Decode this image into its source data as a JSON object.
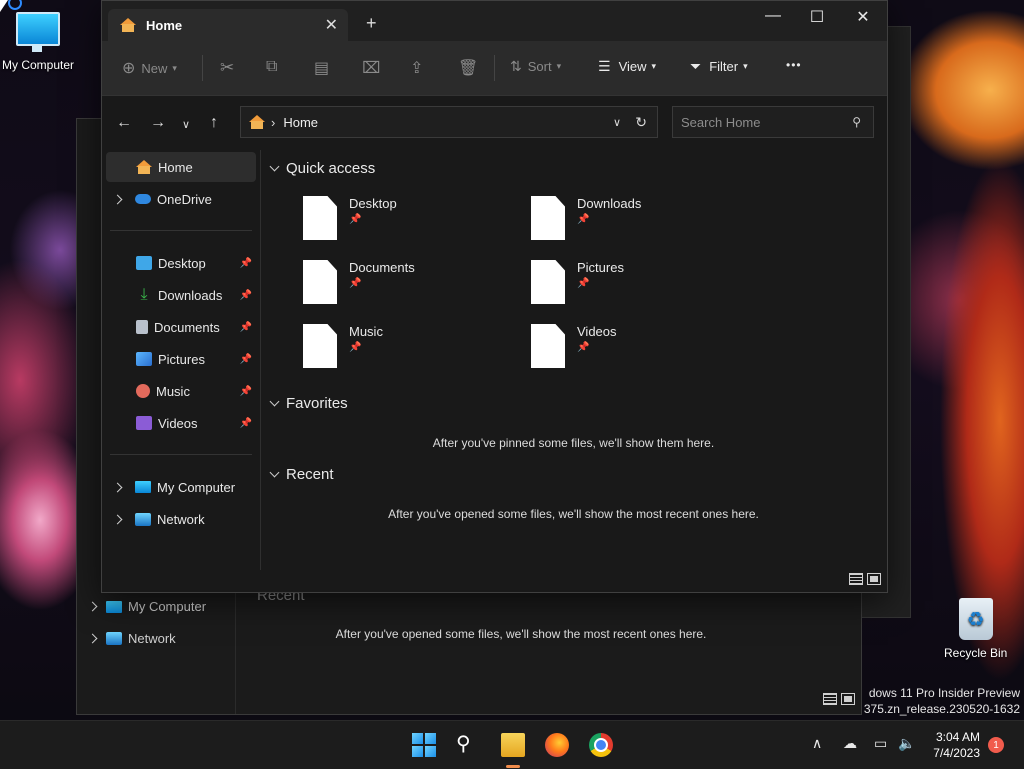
{
  "desktop": {
    "my_computer_label": "My Computer",
    "recycle_bin_label": "Recycle Bin",
    "watermark_line1": "dows 11 Pro Insider Preview",
    "watermark_line2": "375.zn_release.230520-1632"
  },
  "background_window": {
    "nav_my_computer": "My Computer",
    "nav_network": "Network",
    "section_recent": "Recent",
    "recent_message": "After you've opened some files, we'll show the most recent ones here."
  },
  "window": {
    "tab_title": "Home",
    "new_tab_glyph": "+",
    "controls": {
      "minimize": "—",
      "maximize": "☐",
      "close": "✕"
    },
    "toolbar": {
      "new_label": "New",
      "sort_label": "Sort",
      "view_label": "View",
      "filter_label": "Filter",
      "more_label": "•••"
    },
    "address": {
      "path": "Home",
      "separator": "›"
    },
    "search": {
      "placeholder": "Search Home"
    },
    "sidebar": {
      "home": "Home",
      "onedrive": "OneDrive",
      "pinned": [
        {
          "label": "Desktop",
          "icon": "desktop-folder-icon",
          "color": "#3fa7e8"
        },
        {
          "label": "Downloads",
          "icon": "downloads-folder-icon",
          "color": "#39b54a"
        },
        {
          "label": "Documents",
          "icon": "documents-folder-icon",
          "color": "#b9c1cc"
        },
        {
          "label": "Pictures",
          "icon": "pictures-folder-icon",
          "color": "#3e8ede"
        },
        {
          "label": "Music",
          "icon": "music-folder-icon",
          "color": "#e36a5c"
        },
        {
          "label": "Videos",
          "icon": "videos-folder-icon",
          "color": "#8b5cd6"
        }
      ],
      "my_computer": "My Computer",
      "network": "Network"
    },
    "content": {
      "quick_access_title": "Quick access",
      "quick_access": [
        {
          "label": "Desktop"
        },
        {
          "label": "Downloads"
        },
        {
          "label": "Documents"
        },
        {
          "label": "Pictures"
        },
        {
          "label": "Music"
        },
        {
          "label": "Videos"
        }
      ],
      "favorites_title": "Favorites",
      "favorites_message": "After you've pinned some files, we'll show them here.",
      "recent_title": "Recent",
      "recent_message": "After you've opened some files, we'll show the most recent ones here."
    }
  },
  "taskbar": {
    "time": "3:04 AM",
    "date": "7/4/2023",
    "notification_count": "1",
    "accent_color": "#f08c4c"
  }
}
